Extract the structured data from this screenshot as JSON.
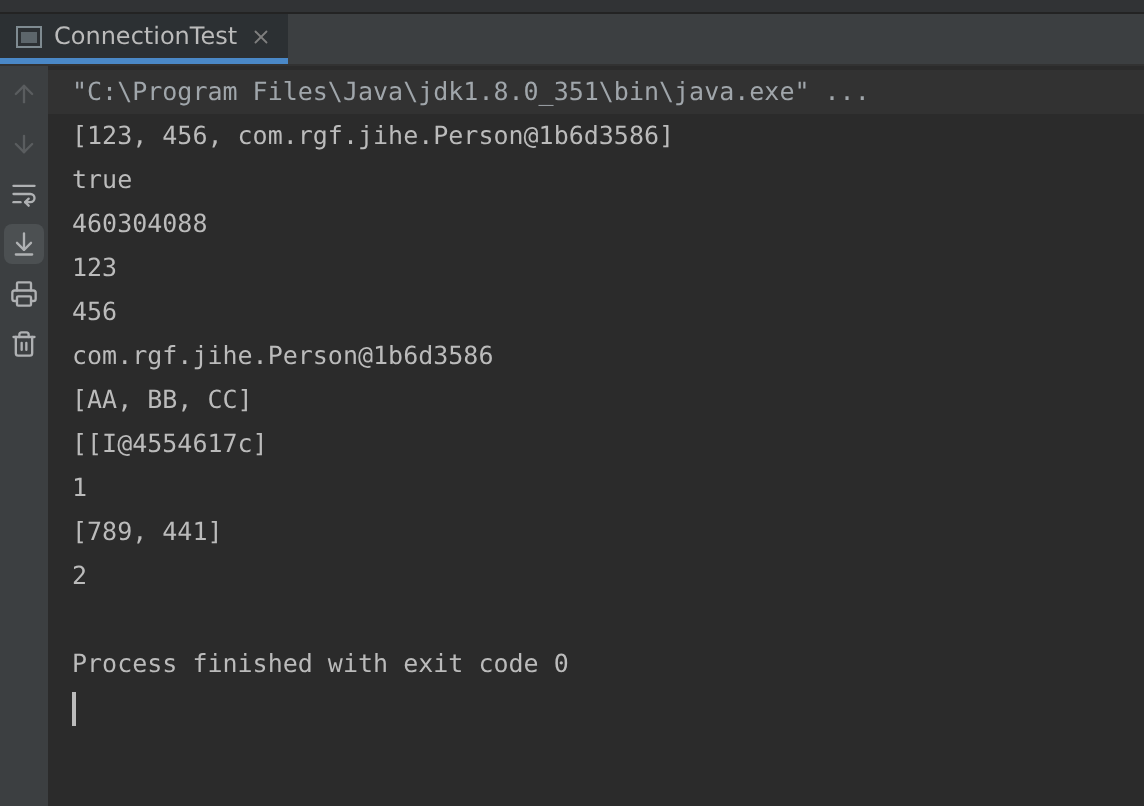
{
  "tabs": [
    {
      "label": "ConnectionTest",
      "selected": true
    }
  ],
  "toolbar": [
    {
      "kind": "up",
      "disabled": true,
      "selected": false
    },
    {
      "kind": "down",
      "disabled": true,
      "selected": false
    },
    {
      "kind": "wrap",
      "disabled": false,
      "selected": false
    },
    {
      "kind": "scroll-end",
      "disabled": false,
      "selected": true
    },
    {
      "kind": "print",
      "disabled": false,
      "selected": false
    },
    {
      "kind": "trash",
      "disabled": false,
      "selected": false
    }
  ],
  "console": {
    "lines": [
      {
        "kind": "command",
        "text": "\"C:\\Program Files\\Java\\jdk1.8.0_351\\bin\\java.exe\" ..."
      },
      {
        "kind": "output",
        "text": "[123, 456, com.rgf.jihe.Person@1b6d3586]"
      },
      {
        "kind": "output",
        "text": "true"
      },
      {
        "kind": "output",
        "text": "460304088"
      },
      {
        "kind": "output",
        "text": "123"
      },
      {
        "kind": "output",
        "text": "456"
      },
      {
        "kind": "output",
        "text": "com.rgf.jihe.Person@1b6d3586"
      },
      {
        "kind": "output",
        "text": "[AA, BB, CC]"
      },
      {
        "kind": "output",
        "text": "[[I@4554617c]"
      },
      {
        "kind": "output",
        "text": "1"
      },
      {
        "kind": "output",
        "text": "[789, 441]"
      },
      {
        "kind": "output",
        "text": "2"
      },
      {
        "kind": "blank"
      },
      {
        "kind": "output",
        "text": "Process finished with exit code 0"
      }
    ],
    "cursor": true
  }
}
